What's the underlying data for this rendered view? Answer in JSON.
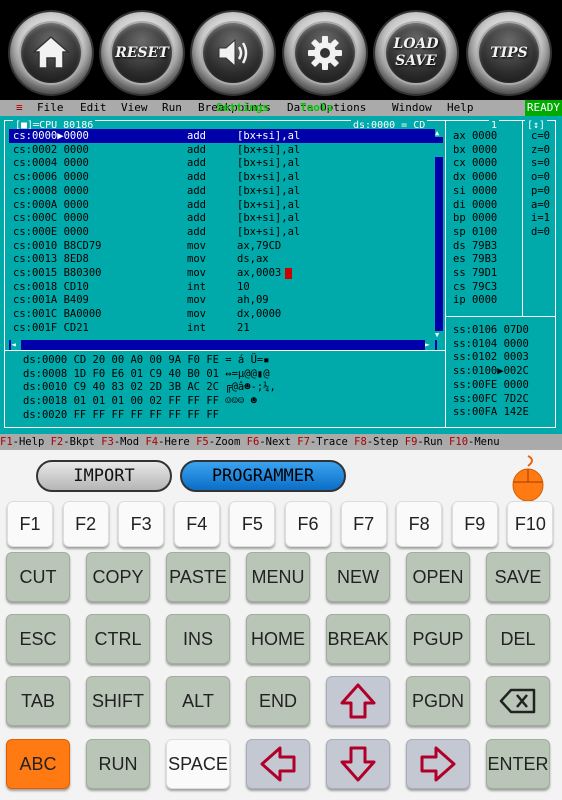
{
  "toolbar": {
    "reset": "RESET",
    "load": "LOAD",
    "save": "SAVE",
    "tips": "TIPS"
  },
  "menubar": {
    "sys": "≡",
    "items": [
      "File",
      "Edit",
      "View",
      "Run",
      "Breakpoints",
      "Data",
      "Options",
      "Window",
      "Help"
    ],
    "overlay_left": "Settings",
    "overlay_right": "Tools",
    "ready": "READY"
  },
  "cpu": {
    "title": "[■]═CPU 80186",
    "ds_title": "ds:0000 = CD",
    "num": "1",
    "rows": [
      {
        "addr": "cs:0000▶0000",
        "op": "add",
        "args": "[bx+si],al"
      },
      {
        "addr": "cs:0002 0000",
        "op": "add",
        "args": "[bx+si],al"
      },
      {
        "addr": "cs:0004 0000",
        "op": "add",
        "args": "[bx+si],al"
      },
      {
        "addr": "cs:0006 0000",
        "op": "add",
        "args": "[bx+si],al"
      },
      {
        "addr": "cs:0008 0000",
        "op": "add",
        "args": "[bx+si],al"
      },
      {
        "addr": "cs:000A 0000",
        "op": "add",
        "args": "[bx+si],al"
      },
      {
        "addr": "cs:000C 0000",
        "op": "add",
        "args": "[bx+si],al"
      },
      {
        "addr": "cs:000E 0000",
        "op": "add",
        "args": "[bx+si],al"
      },
      {
        "addr": "cs:0010 B8CD79",
        "op": "mov",
        "args": "ax,79CD"
      },
      {
        "addr": "cs:0013 8ED8",
        "op": "mov",
        "args": "ds,ax"
      },
      {
        "addr": "cs:0015 B80300",
        "op": "mov",
        "args": "ax,0003"
      },
      {
        "addr": "cs:0018 CD10",
        "op": "int",
        "args": "10"
      },
      {
        "addr": "cs:001A B409",
        "op": "mov",
        "args": "ah,09"
      },
      {
        "addr": "cs:001C BA0000",
        "op": "mov",
        "args": "dx,0000"
      },
      {
        "addr": "cs:001F CD21",
        "op": "int",
        "args": "21"
      }
    ],
    "registers": [
      "ax 0000",
      "bx 0000",
      "cx 0000",
      "dx 0000",
      "si 0000",
      "di 0000",
      "bp 0000",
      "sp 0100",
      "ds 79B3",
      "es 79B3",
      "ss 79D1",
      "cs 79C3",
      "ip 0000"
    ],
    "flags": [
      "c=0",
      "z=0",
      "s=0",
      "o=0",
      "p=0",
      "a=0",
      "i=1",
      "d=0"
    ],
    "dump": [
      "ds:0000 CD 20 00 A0 00 9A F0 FE = á Ü=▪",
      "ds:0008 1D F0 E6 01 C9 40 B0 01 ↔=µ@@▮@",
      "ds:0010 C9 40 83 02 2D 3B AC 2C ╔@â☻-;¼,",
      "ds:0018 01 01 01 00 02 FF FF FF ☺☺☺ ☻",
      "ds:0020 FF FF FF FF FF FF FF FF"
    ],
    "stack": [
      "ss:0106 07D0",
      "ss:0104 0000",
      "ss:0102 0003",
      "ss:0100▶002C",
      "ss:00FE 0000",
      "ss:00FC 7D2C",
      "ss:00FA 142E"
    ]
  },
  "fnkeys": [
    {
      "k": "F1",
      "t": "-Help"
    },
    {
      "k": "F2",
      "t": "-Bkpt"
    },
    {
      "k": "F3",
      "t": "-Mod"
    },
    {
      "k": "F4",
      "t": "-Here"
    },
    {
      "k": "F5",
      "t": "-Zoom"
    },
    {
      "k": "F6",
      "t": "-Next"
    },
    {
      "k": "F7",
      "t": "-Trace"
    },
    {
      "k": "F8",
      "t": "-Step"
    },
    {
      "k": "F9",
      "t": "-Run"
    },
    {
      "k": "F10",
      "t": "-Menu"
    }
  ],
  "keyboard": {
    "import": "IMPORT",
    "programmer": "PROGRAMMER",
    "fkeys": [
      "F1",
      "F2",
      "F3",
      "F4",
      "F5",
      "F6",
      "F7",
      "F8",
      "F9",
      "F10"
    ],
    "row1": [
      "CUT",
      "COPY",
      "PASTE",
      "MENU",
      "NEW",
      "OPEN",
      "SAVE"
    ],
    "row2": [
      "ESC",
      "CTRL",
      "INS",
      "HOME",
      "BREAK",
      "PGUP",
      "DEL"
    ],
    "row3": [
      "TAB",
      "SHIFT",
      "ALT",
      "END",
      "",
      "PGDN",
      ""
    ],
    "row4": [
      "ABC",
      "RUN",
      "SPACE",
      "",
      "",
      "",
      "ENTER"
    ]
  },
  "colors": {
    "accent_orange": "#ff7a12",
    "programmer_blue": "#1e88e5",
    "dos_cyan": "#00aaaa"
  }
}
